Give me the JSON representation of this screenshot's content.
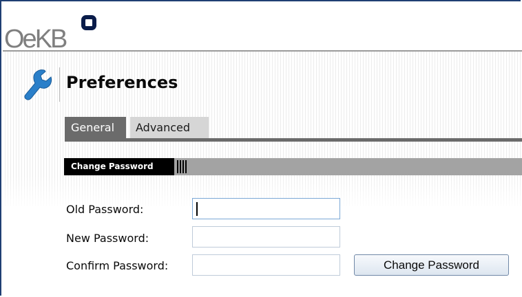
{
  "brand": {
    "logo_text": "OeKB"
  },
  "page": {
    "title": "Preferences",
    "icon": "wrench-icon"
  },
  "tabs": [
    {
      "label": "General",
      "active": true
    },
    {
      "label": "Advanced",
      "active": false
    }
  ],
  "section": {
    "title": "Change Password"
  },
  "form": {
    "old_password_label": "Old Password:",
    "new_password_label": "New Password:",
    "confirm_password_label": "Confirm Password:",
    "old_password_value": "",
    "new_password_value": "",
    "confirm_password_value": "",
    "submit_label": "Change Password"
  },
  "colors": {
    "window_border": "#1f3f73",
    "logo_mark": "#0a1c4a",
    "icon_blue": "#2a7fc9",
    "tab_active": "#6b6b6b",
    "tab_inactive": "#d6d6d6",
    "section_bar": "#a3a3a3"
  }
}
